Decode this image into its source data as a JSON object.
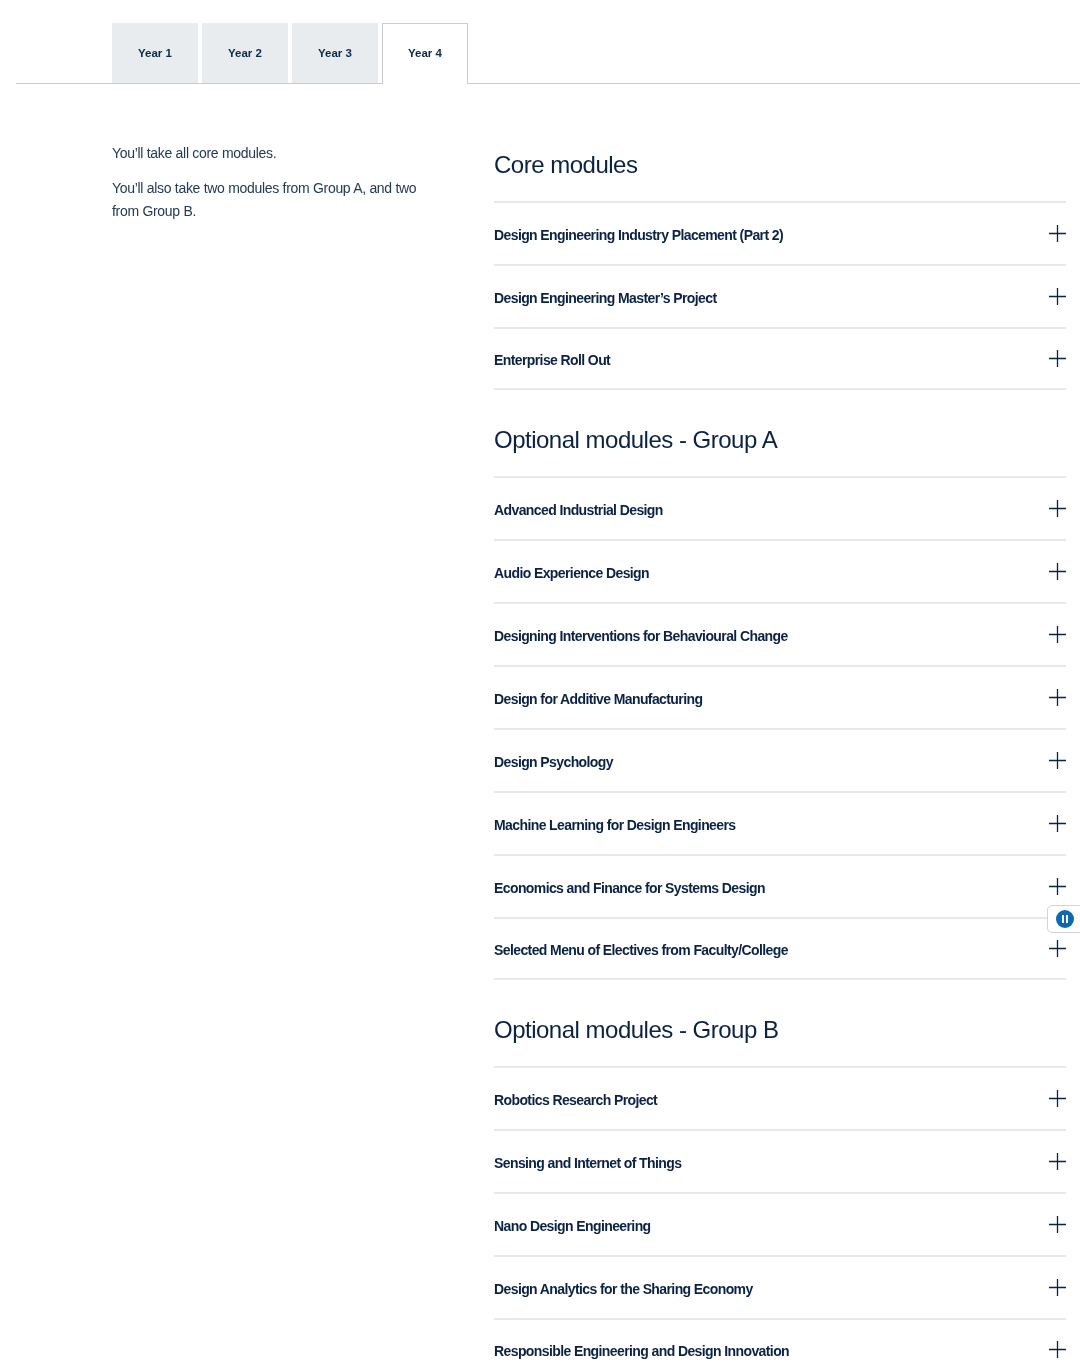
{
  "tabs": [
    {
      "label": "Year 1",
      "selected": false
    },
    {
      "label": "Year 2",
      "selected": false
    },
    {
      "label": "Year 3",
      "selected": false
    },
    {
      "label": "Year 4",
      "selected": true
    }
  ],
  "intro": [
    "You’ll take all core modules.",
    "You’ll also take two modules from Group A, and two from Group B."
  ],
  "sections": [
    {
      "title": "Core modules",
      "modules": [
        {
          "name": "Design Engineering Industry Placement (Part 2)",
          "expanded": false
        },
        {
          "name": "Design Engineering Master’s Project",
          "expanded": false
        },
        {
          "name": "Enterprise Roll Out",
          "expanded": false
        }
      ]
    },
    {
      "title": "Optional modules - Group A",
      "modules": [
        {
          "name": "Advanced Industrial Design",
          "expanded": false
        },
        {
          "name": "Audio Experience Design",
          "expanded": false
        },
        {
          "name": "Designing Interventions for Behavioural Change",
          "expanded": false
        },
        {
          "name": "Design for Additive Manufacturing",
          "expanded": false
        },
        {
          "name": "Design Psychology",
          "expanded": false
        },
        {
          "name": "Machine Learning for Design Engineers",
          "expanded": false
        },
        {
          "name": "Economics and Finance for Systems Design",
          "expanded": false
        },
        {
          "name": "Selected Menu of Electives from Faculty/College",
          "expanded": false
        }
      ]
    },
    {
      "title": "Optional modules - Group B",
      "modules": [
        {
          "name": "Robotics Research Project",
          "expanded": false
        },
        {
          "name": "Sensing and Internet of Things",
          "expanded": false
        },
        {
          "name": "Nano Design Engineering",
          "expanded": false
        },
        {
          "name": "Design Analytics for the Sharing Economy",
          "expanded": false
        },
        {
          "name": "Responsible Engineering and Design Innovation",
          "expanded": false
        }
      ]
    }
  ]
}
